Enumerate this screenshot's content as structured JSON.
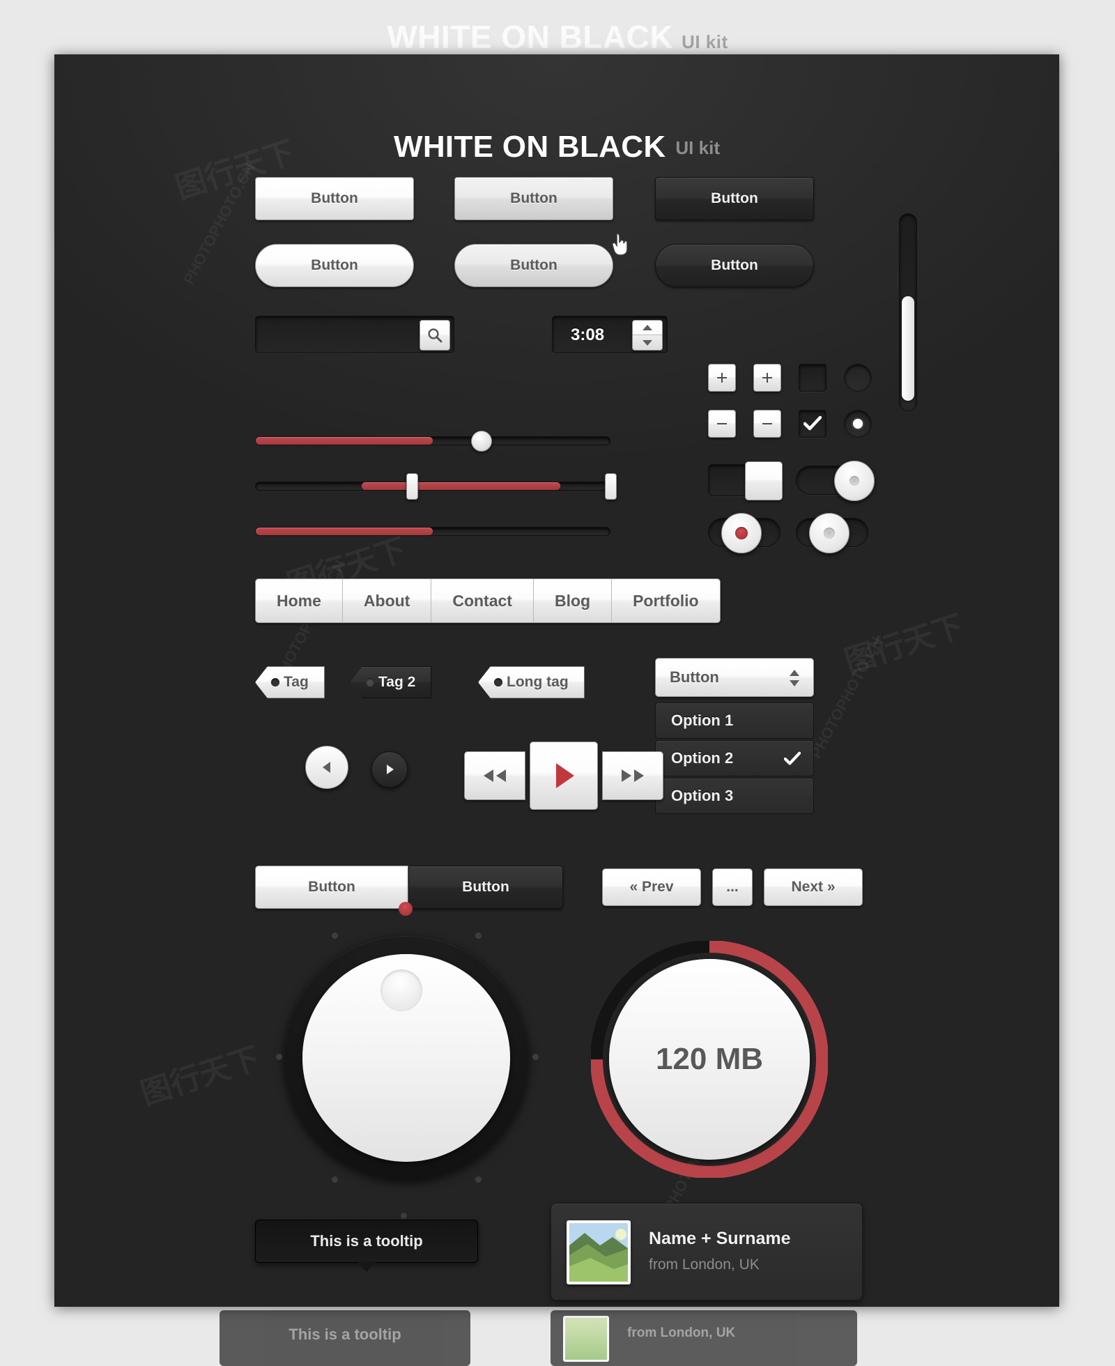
{
  "header": {
    "title": "WHITE ON BLACK",
    "subtitle": "UI kit"
  },
  "colors": {
    "accent_red": "#b8444a",
    "panel_bg": "#2b2b2b",
    "white_surface": "#fafafa",
    "text_dark": "#5b5b5b"
  },
  "buttons": {
    "rect_default": "Button",
    "rect_hover": "Button",
    "rect_dark": "Button",
    "pill_default": "Button",
    "pill_hover": "Button",
    "pill_dark": "Button"
  },
  "search": {
    "value": "",
    "placeholder": "",
    "icon": "search-icon"
  },
  "stepper": {
    "value": "3:08",
    "up_icon": "triangle-up-icon",
    "down_icon": "triangle-down-icon"
  },
  "icon_grid": {
    "plus_light": "plus-icon",
    "plus_dark": "plus-icon",
    "minus_light": "minus-icon",
    "minus_dark": "minus-icon",
    "checkbox_unchecked": "checkbox-empty-icon",
    "checkbox_checked": "check-icon",
    "radio_unchecked": "radio-empty-icon",
    "radio_checked": "radio-selected-icon"
  },
  "sliders": [
    {
      "name": "single-handle-slider",
      "fill_percent": 50
    },
    {
      "name": "range-slider",
      "start_percent": 30,
      "end_percent": 86
    },
    {
      "name": "progress-slider",
      "fill_percent": 50
    }
  ],
  "scrollbar": {
    "thumb_percent": 40
  },
  "toggles": [
    {
      "name": "toggle-square-knob",
      "state": "on"
    },
    {
      "name": "toggle-round-knob",
      "state": "on"
    },
    {
      "name": "toggle-red-dot",
      "state": "on"
    },
    {
      "name": "toggle-grey-dot",
      "state": "on"
    }
  ],
  "nav": {
    "items": [
      "Home",
      "About",
      "Contact",
      "Blog",
      "Portfolio"
    ]
  },
  "tags": [
    {
      "label": "Tag",
      "style": "light"
    },
    {
      "label": "Tag 2",
      "style": "dark"
    },
    {
      "label": "Long tag",
      "style": "light"
    }
  ],
  "select": {
    "label": "Button",
    "arrows_icon": "chevron-updown-icon",
    "options": [
      {
        "label": "Option 1",
        "checked": false
      },
      {
        "label": "Option 2",
        "checked": true
      },
      {
        "label": "Option 3",
        "checked": false
      }
    ]
  },
  "media": {
    "prev_small": "prev-icon",
    "next_small": "next-icon",
    "rewind": "rewind-icon",
    "play": "play-icon",
    "forward": "fast-forward-icon"
  },
  "segmented": {
    "left": "Button",
    "right": "Button",
    "active": "right"
  },
  "pagination": {
    "prev": "« Prev",
    "ellipsis": "...",
    "next": "Next »"
  },
  "knob": {
    "name": "rotary-knob",
    "indicator": "red-dot"
  },
  "gauge": {
    "value": "120 MB",
    "percent": 75
  },
  "tooltip": {
    "text": "This is a tooltip"
  },
  "profile_card": {
    "name": "Name + Surname",
    "location": "from London, UK",
    "avatar": "landscape-photo"
  },
  "watermarks": [
    "PHOTOPHOTO.CN",
    "图行天下"
  ]
}
